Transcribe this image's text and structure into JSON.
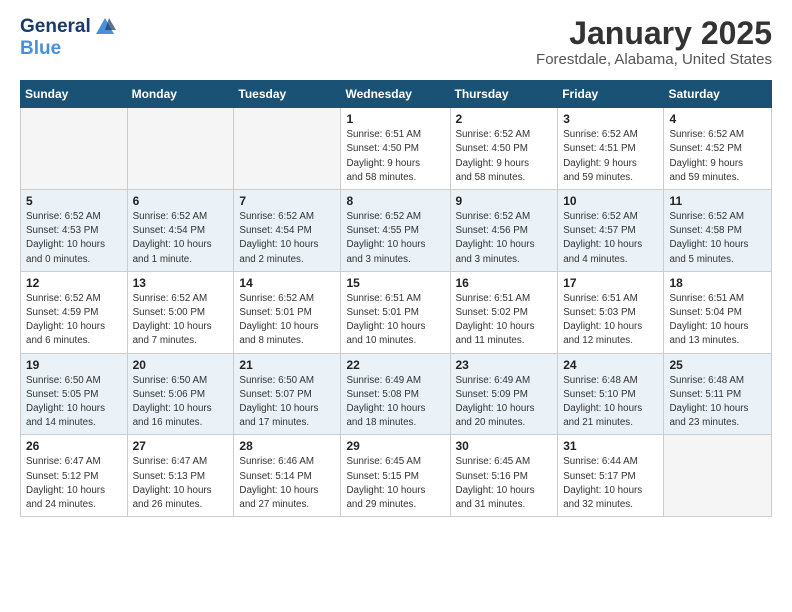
{
  "header": {
    "logo_general": "General",
    "logo_blue": "Blue",
    "title": "January 2025",
    "subtitle": "Forestdale, Alabama, United States"
  },
  "weekdays": [
    "Sunday",
    "Monday",
    "Tuesday",
    "Wednesday",
    "Thursday",
    "Friday",
    "Saturday"
  ],
  "weeks": [
    [
      {
        "day": "",
        "info": ""
      },
      {
        "day": "",
        "info": ""
      },
      {
        "day": "",
        "info": ""
      },
      {
        "day": "1",
        "info": "Sunrise: 6:51 AM\nSunset: 4:50 PM\nDaylight: 9 hours\nand 58 minutes."
      },
      {
        "day": "2",
        "info": "Sunrise: 6:52 AM\nSunset: 4:50 PM\nDaylight: 9 hours\nand 58 minutes."
      },
      {
        "day": "3",
        "info": "Sunrise: 6:52 AM\nSunset: 4:51 PM\nDaylight: 9 hours\nand 59 minutes."
      },
      {
        "day": "4",
        "info": "Sunrise: 6:52 AM\nSunset: 4:52 PM\nDaylight: 9 hours\nand 59 minutes."
      }
    ],
    [
      {
        "day": "5",
        "info": "Sunrise: 6:52 AM\nSunset: 4:53 PM\nDaylight: 10 hours\nand 0 minutes."
      },
      {
        "day": "6",
        "info": "Sunrise: 6:52 AM\nSunset: 4:54 PM\nDaylight: 10 hours\nand 1 minute."
      },
      {
        "day": "7",
        "info": "Sunrise: 6:52 AM\nSunset: 4:54 PM\nDaylight: 10 hours\nand 2 minutes."
      },
      {
        "day": "8",
        "info": "Sunrise: 6:52 AM\nSunset: 4:55 PM\nDaylight: 10 hours\nand 3 minutes."
      },
      {
        "day": "9",
        "info": "Sunrise: 6:52 AM\nSunset: 4:56 PM\nDaylight: 10 hours\nand 3 minutes."
      },
      {
        "day": "10",
        "info": "Sunrise: 6:52 AM\nSunset: 4:57 PM\nDaylight: 10 hours\nand 4 minutes."
      },
      {
        "day": "11",
        "info": "Sunrise: 6:52 AM\nSunset: 4:58 PM\nDaylight: 10 hours\nand 5 minutes."
      }
    ],
    [
      {
        "day": "12",
        "info": "Sunrise: 6:52 AM\nSunset: 4:59 PM\nDaylight: 10 hours\nand 6 minutes."
      },
      {
        "day": "13",
        "info": "Sunrise: 6:52 AM\nSunset: 5:00 PM\nDaylight: 10 hours\nand 7 minutes."
      },
      {
        "day": "14",
        "info": "Sunrise: 6:52 AM\nSunset: 5:01 PM\nDaylight: 10 hours\nand 8 minutes."
      },
      {
        "day": "15",
        "info": "Sunrise: 6:51 AM\nSunset: 5:01 PM\nDaylight: 10 hours\nand 10 minutes."
      },
      {
        "day": "16",
        "info": "Sunrise: 6:51 AM\nSunset: 5:02 PM\nDaylight: 10 hours\nand 11 minutes."
      },
      {
        "day": "17",
        "info": "Sunrise: 6:51 AM\nSunset: 5:03 PM\nDaylight: 10 hours\nand 12 minutes."
      },
      {
        "day": "18",
        "info": "Sunrise: 6:51 AM\nSunset: 5:04 PM\nDaylight: 10 hours\nand 13 minutes."
      }
    ],
    [
      {
        "day": "19",
        "info": "Sunrise: 6:50 AM\nSunset: 5:05 PM\nDaylight: 10 hours\nand 14 minutes."
      },
      {
        "day": "20",
        "info": "Sunrise: 6:50 AM\nSunset: 5:06 PM\nDaylight: 10 hours\nand 16 minutes."
      },
      {
        "day": "21",
        "info": "Sunrise: 6:50 AM\nSunset: 5:07 PM\nDaylight: 10 hours\nand 17 minutes."
      },
      {
        "day": "22",
        "info": "Sunrise: 6:49 AM\nSunset: 5:08 PM\nDaylight: 10 hours\nand 18 minutes."
      },
      {
        "day": "23",
        "info": "Sunrise: 6:49 AM\nSunset: 5:09 PM\nDaylight: 10 hours\nand 20 minutes."
      },
      {
        "day": "24",
        "info": "Sunrise: 6:48 AM\nSunset: 5:10 PM\nDaylight: 10 hours\nand 21 minutes."
      },
      {
        "day": "25",
        "info": "Sunrise: 6:48 AM\nSunset: 5:11 PM\nDaylight: 10 hours\nand 23 minutes."
      }
    ],
    [
      {
        "day": "26",
        "info": "Sunrise: 6:47 AM\nSunset: 5:12 PM\nDaylight: 10 hours\nand 24 minutes."
      },
      {
        "day": "27",
        "info": "Sunrise: 6:47 AM\nSunset: 5:13 PM\nDaylight: 10 hours\nand 26 minutes."
      },
      {
        "day": "28",
        "info": "Sunrise: 6:46 AM\nSunset: 5:14 PM\nDaylight: 10 hours\nand 27 minutes."
      },
      {
        "day": "29",
        "info": "Sunrise: 6:45 AM\nSunset: 5:15 PM\nDaylight: 10 hours\nand 29 minutes."
      },
      {
        "day": "30",
        "info": "Sunrise: 6:45 AM\nSunset: 5:16 PM\nDaylight: 10 hours\nand 31 minutes."
      },
      {
        "day": "31",
        "info": "Sunrise: 6:44 AM\nSunset: 5:17 PM\nDaylight: 10 hours\nand 32 minutes."
      },
      {
        "day": "",
        "info": ""
      }
    ]
  ]
}
